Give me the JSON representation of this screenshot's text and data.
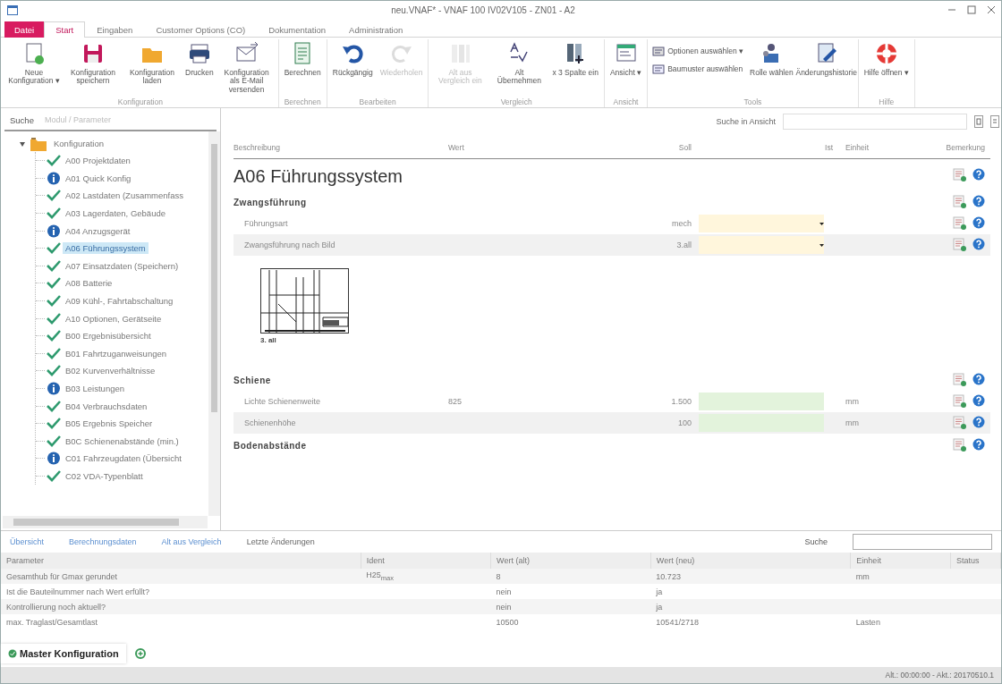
{
  "window": {
    "title": "neu.VNAF* - VNAF 100 IV02V105 - ZN01 - A2"
  },
  "menu_tabs": [
    {
      "label": "Datei",
      "selected": false,
      "kind": "file"
    },
    {
      "label": "Start",
      "selected": true,
      "kind": "tab"
    },
    {
      "label": "Eingaben",
      "selected": false,
      "kind": "tab"
    },
    {
      "label": "Customer Options (CO)",
      "selected": false,
      "kind": "tab"
    },
    {
      "label": "Dokumentation",
      "selected": false,
      "kind": "tab"
    },
    {
      "label": "Administration",
      "selected": false,
      "kind": "tab"
    }
  ],
  "ribbon": [
    {
      "group": "Konfiguration",
      "buttons": [
        {
          "label": "Neue Konfiguration ▾",
          "disabled": false,
          "kind": "large"
        },
        {
          "label": "Konfiguration speichern",
          "disabled": false,
          "kind": "large"
        },
        {
          "label": "Konfiguration laden",
          "disabled": false,
          "kind": "large"
        },
        {
          "label": "Drucken",
          "disabled": false,
          "kind": "large"
        },
        {
          "label": "Konfiguration als E-Mail versenden",
          "disabled": false,
          "kind": "large"
        }
      ]
    },
    {
      "group": "Berechnen",
      "buttons": [
        {
          "label": "Berechnen",
          "disabled": false,
          "kind": "large"
        }
      ]
    },
    {
      "group": "Bearbeiten",
      "buttons": [
        {
          "label": "Rückgängig",
          "disabled": false,
          "kind": "large"
        },
        {
          "label": "Wiederholen",
          "disabled": true,
          "kind": "large"
        }
      ]
    },
    {
      "group": "Vergleich",
      "buttons": [
        {
          "label": "Alt aus Vergleich ein",
          "disabled": true,
          "kind": "large"
        },
        {
          "label": "Alt Übernehmen",
          "disabled": false,
          "kind": "large"
        },
        {
          "label": "x 3 Spalte ein",
          "disabled": false,
          "kind": "large"
        }
      ]
    },
    {
      "group": "Ansicht",
      "buttons": [
        {
          "label": "Ansicht ▾",
          "disabled": false,
          "kind": "large"
        }
      ]
    },
    {
      "group": "Tools",
      "buttons": [
        {
          "label": "Optionen auswählen ▾",
          "disabled": false,
          "kind": "small"
        },
        {
          "label": "Baumuster auswählen",
          "disabled": false,
          "kind": "small"
        },
        {
          "label": "Rolle wählen",
          "disabled": false,
          "kind": "large"
        },
        {
          "label": "Änderungshistorie",
          "disabled": false,
          "kind": "large"
        }
      ]
    },
    {
      "group": "Hilfe",
      "buttons": [
        {
          "label": "Hilfe öffnen ▾",
          "disabled": false,
          "kind": "large"
        }
      ]
    }
  ],
  "sidebar": {
    "search_label": "Suche",
    "search_placeholder": "Modul / Parameter",
    "tree": [
      {
        "label": "Konfiguration",
        "expanded": true,
        "children": [
          {
            "label": "A00 Projektdaten",
            "kind": "done",
            "selected": false
          },
          {
            "label": "A01 Quick Konfig",
            "kind": "info",
            "selected": false
          },
          {
            "label": "A02 Lastdaten (Zusammenfass",
            "kind": "done",
            "selected": false
          },
          {
            "label": "A03 Lagerdaten, Gebäude",
            "kind": "done",
            "selected": false
          },
          {
            "label": "A04 Anzugsgerät",
            "kind": "info",
            "selected": false
          },
          {
            "label": "A06 Führungssystem",
            "kind": "done",
            "selected": true
          },
          {
            "label": "A07 Einsatzdaten (Speichern)",
            "kind": "done",
            "selected": false
          },
          {
            "label": "A08 Batterie",
            "kind": "done",
            "selected": false
          },
          {
            "label": "A09 Kühl-, Fahrtabschaltung",
            "kind": "done",
            "selected": false
          },
          {
            "label": "A10 Optionen, Gerätseite",
            "kind": "done",
            "selected": false
          },
          {
            "label": "B00 Ergebnisübersicht",
            "kind": "done",
            "selected": false
          },
          {
            "label": "B01 Fahrtzuganweisungen",
            "kind": "done",
            "selected": false
          },
          {
            "label": "B02 Kurvenverhältnisse",
            "kind": "done",
            "selected": false
          },
          {
            "label": "B03 Leistungen",
            "kind": "info",
            "selected": false
          },
          {
            "label": "B04 Verbrauchsdaten",
            "kind": "done",
            "selected": false
          },
          {
            "label": "B05 Ergebnis Speicher",
            "kind": "done",
            "selected": false
          },
          {
            "label": "B0C Schienenabstände (min.)",
            "kind": "done",
            "selected": false
          },
          {
            "label": "C01 Fahrzeugdaten (Übersicht",
            "kind": "info",
            "selected": false
          },
          {
            "label": "C02 VDA-Typenblatt",
            "kind": "done",
            "selected": false
          }
        ]
      }
    ]
  },
  "editor": {
    "search_label": "Suche in Ansicht",
    "columns": [
      "Beschreibung",
      "Wert",
      "Soll",
      "Ist",
      "Einheit",
      "Bemerkung"
    ],
    "rows": [
      {
        "kind": "title",
        "label": "A06 Führungssystem"
      },
      {
        "kind": "section",
        "label": "Zwangsführung"
      },
      {
        "kind": "dropdown",
        "label": "Führungsart",
        "soll": "mech",
        "color": "#fff6dc"
      },
      {
        "kind": "dropdown",
        "label": "Zwangsführung nach Bild",
        "soll": "3.all",
        "color": "#fff6dc"
      },
      {
        "kind": "image",
        "caption": "3. all"
      },
      {
        "kind": "section",
        "label": "Schiene"
      },
      {
        "kind": "input",
        "label": "Lichte Schienenweite",
        "wert": "825",
        "soll": "1.500",
        "color": "#e3f3dc",
        "unit": "mm"
      },
      {
        "kind": "input",
        "label": "Schienenhöhe",
        "soll": "100",
        "color": "#e3f3dc",
        "unit": "mm"
      },
      {
        "kind": "section",
        "label": "Bodenabstände"
      }
    ]
  },
  "changes": {
    "tabs": [
      {
        "label": "Übersicht",
        "selected": false
      },
      {
        "label": "Berechnungsdaten",
        "selected": false
      },
      {
        "label": "Alt aus Vergleich",
        "selected": false
      },
      {
        "label": "Letzte Änderungen",
        "selected": true
      }
    ],
    "search_label": "Suche",
    "columns": [
      "Parameter",
      "Ident",
      "Wert (alt)",
      "Wert (neu)",
      "Einheit",
      "Status"
    ],
    "rows": [
      [
        "Gesamthub für Gmax gerundet",
        "H25$_{max}$",
        "8",
        "10.723",
        "mm",
        ""
      ],
      [
        "Ist die Bauteilnummer nach Wert erfüllt?",
        "",
        "nein",
        "ja",
        "",
        ""
      ],
      [
        "Kontrollierung noch aktuell?",
        "",
        "nein",
        "ja",
        "",
        ""
      ],
      [
        "max. Traglast/Gesamtlast",
        "",
        "10500",
        "10541/2718",
        "Lasten",
        ""
      ]
    ]
  },
  "documents": [
    {
      "label": "Master Konfiguration",
      "selected": true
    }
  ],
  "status_bar": {
    "text": "Alt.: 00:00:00 - Akt.: 20170510.1"
  }
}
